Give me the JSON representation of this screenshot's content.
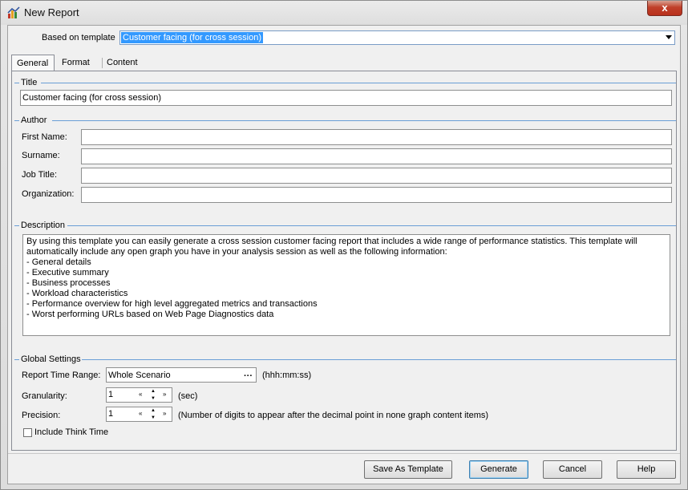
{
  "window": {
    "title": "New Report",
    "close_glyph": "x"
  },
  "template": {
    "label": "Based on template",
    "value": "Customer facing (for cross session)"
  },
  "tabs": [
    {
      "label": "General",
      "active": true
    },
    {
      "label": "Format",
      "active": false
    },
    {
      "label": "Content",
      "active": false
    }
  ],
  "title_group": {
    "heading": "Title",
    "value": "Customer facing (for cross session)"
  },
  "author": {
    "heading": "Author",
    "first_name_label": "First Name:",
    "first_name": "",
    "surname_label": "Surname:",
    "surname": "",
    "job_title_label": "Job Title:",
    "job_title": "",
    "organization_label": "Organization:",
    "organization": ""
  },
  "description": {
    "heading": "Description",
    "lines": [
      "By using this template you can easily generate a cross session customer facing report that includes a wide range of performance statistics. This template will",
      "automatically include any open graph you have in your analysis session as well as the following information:",
      "- General details",
      "- Executive summary",
      "- Business processes",
      "- Workload characteristics",
      "- Performance overview for high level aggregated metrics and transactions",
      "- Worst performing URLs based on Web Page Diagnostics data"
    ]
  },
  "global": {
    "heading": "Global Settings",
    "time_range_label": "Report Time Range:",
    "time_range_value": "Whole Scenario",
    "time_range_button": "···",
    "time_range_hint": "(hhh:mm:ss)",
    "granularity_label": "Granularity:",
    "granularity_value": "1",
    "granularity_hint": "(sec)",
    "precision_label": "Precision:",
    "precision_value": "1",
    "precision_hint": "(Number of digits to appear after the decimal point in none graph content items)",
    "think_time_label": "Include Think Time",
    "think_time_checked": false,
    "spin_first": "«",
    "spin_last": "»",
    "spin_up": "▲",
    "spin_down": "▼"
  },
  "buttons": {
    "save_as_template": "Save As Template",
    "generate": "Generate",
    "cancel": "Cancel",
    "help": "Help"
  },
  "colors": {
    "selection": "#3399ff",
    "group_line": "#6a9ed6",
    "close_button": "#c0402a"
  }
}
